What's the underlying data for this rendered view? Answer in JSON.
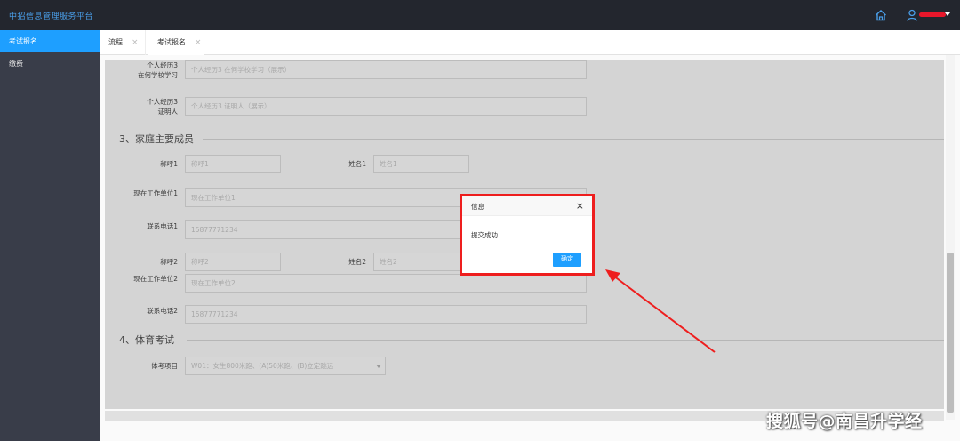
{
  "header": {
    "brand": "中招信息管理服务平台",
    "user_name_redacted_color": "#e8172b"
  },
  "sidebar": {
    "items": [
      {
        "label": "考试报名",
        "active": true
      },
      {
        "label": "缴费",
        "active": false
      }
    ]
  },
  "tabs": [
    {
      "label": "流程",
      "close": "×"
    },
    {
      "label": "考试报名",
      "close": "×"
    }
  ],
  "form": {
    "resume3_school": {
      "label": "个人经历3在何学校学习",
      "label_line1": "个人经历3",
      "label_line2": "在何学校学习",
      "placeholder": "个人经历3 在何学校学习（展示）"
    },
    "resume3_witness": {
      "label_line1": "个人经历3",
      "label_line2": "证明人",
      "placeholder": "个人经历3 证明人（展示）"
    },
    "section_family": "3、家庭主要成员",
    "member1": {
      "title_label": "称呼1",
      "title_placeholder": "称呼1",
      "name_label": "姓名1",
      "name_placeholder": "姓名1",
      "work_label": "现在工作单位1",
      "work_placeholder": "现在工作单位1",
      "phone_label": "联系电话1",
      "phone_placeholder": "15877771234"
    },
    "member2": {
      "title_label": "称呼2",
      "title_placeholder": "称呼2",
      "name_label": "姓名2",
      "name_placeholder": "姓名2",
      "work_label": "现在工作单位2",
      "work_placeholder": "现在工作单位2",
      "phone_label": "联系电话2",
      "phone_placeholder": "15877771234"
    },
    "section_pe": "4、体育考试",
    "pe_item": {
      "label": "体考项目",
      "value": "W01：女生800米跑、(A)50米跑、(B)立定跳远"
    }
  },
  "dialog": {
    "title": "信息",
    "close": "×",
    "message": "提交成功",
    "ok_label": "确定",
    "highlight_color": "#ee1e1e"
  },
  "accent_color": "#1e9fff",
  "watermark": "搜狐号@南昌升学经"
}
